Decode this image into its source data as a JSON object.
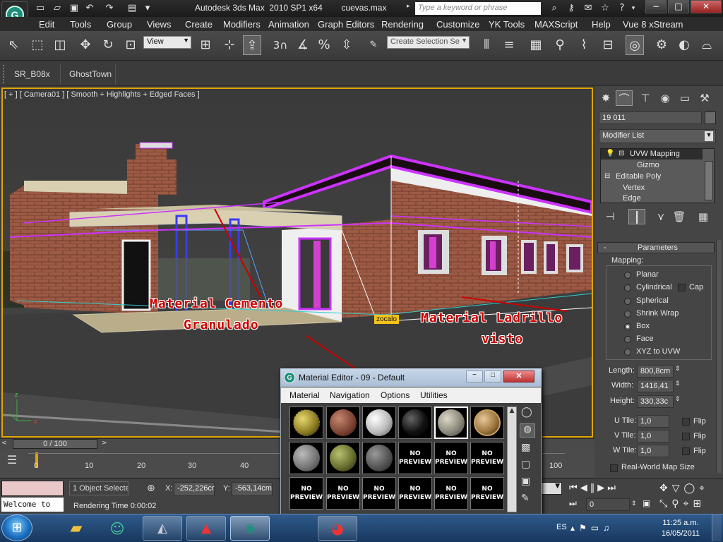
{
  "titlebar": {
    "title": "Autodesk 3ds Max  2010 SP1 x64",
    "filename": "cuevas.max",
    "search_placeholder": "Type a keyword or phrase",
    "min": "−",
    "max": "□",
    "close": "✕"
  },
  "menubar": {
    "items": [
      "Edit",
      "Tools",
      "Group",
      "Views",
      "Create",
      "Modifiers",
      "Animation",
      "Graph Editors",
      "Rendering",
      "Customize",
      "YK Tools",
      "MAXScript",
      "Help",
      "Vue 8 xStream"
    ]
  },
  "toolbar": {
    "refcoord": "View",
    "selection_set_placeholder": "Create Selection Se",
    "snap_label": "3"
  },
  "tabs2": [
    "SR_B08x",
    "GhostTown"
  ],
  "viewport": {
    "label": "[ + ] [ Camera01 ] [ Smooth + Highlights + Edged Faces ]",
    "annot1a": "Material Cemento",
    "annot1b": "Granulado",
    "annot2a": "Material Ladrillo",
    "annot2b": "visto",
    "tag": "zocalo"
  },
  "cmdpanel": {
    "object_name": "19   011",
    "modifier_list": "Modifier List",
    "stack": [
      "UVW Mapping",
      "Gizmo",
      "Editable Poly",
      "Vertex",
      "Edge"
    ],
    "rollout": "Parameters",
    "mapping_label": "Mapping:",
    "mapping_options": [
      "Planar",
      "Cylindrical",
      "Spherical",
      "Shrink Wrap",
      "Box",
      "Face",
      "XYZ to UVW"
    ],
    "mapping_selected": "Box",
    "cap": "Cap",
    "length_label": "Length:",
    "length": "800,8cm",
    "width_label": "Width:",
    "width": "1416,41",
    "height_label": "Height:",
    "height": "330,33c",
    "utile_label": "U Tile:",
    "utile": "1,0",
    "vtile_label": "V Tile:",
    "vtile": "1,0",
    "wtile_label": "W Tile:",
    "wtile": "1,0",
    "flip": "Flip",
    "realworld": "Real-World Map Size"
  },
  "timeline": {
    "frame": "0 / 100",
    "ticks": [
      "0",
      "10",
      "20",
      "30",
      "40",
      "100"
    ]
  },
  "status": {
    "welcome": "Welcome to",
    "selected": "1 Object Selecte",
    "x_label": "X:",
    "x": "-252,226cr",
    "y_label": "Y:",
    "y": "-563,14cm",
    "rendering": "Rendering Time  0:00:02",
    "frame_field": "0"
  },
  "mated": {
    "title": "Material Editor - 09 - Default",
    "menu": [
      "Material",
      "Navigation",
      "Options",
      "Utilities"
    ],
    "preview_text": "NO PREVIEW"
  },
  "taskbar": {
    "lang": "ES",
    "time": "11:25 a.m.",
    "date": "16/05/2011"
  },
  "colors": {
    "viewport_border": "#e0a400",
    "annotation": "#cc0000",
    "selection_wire": "#cc33ff"
  }
}
